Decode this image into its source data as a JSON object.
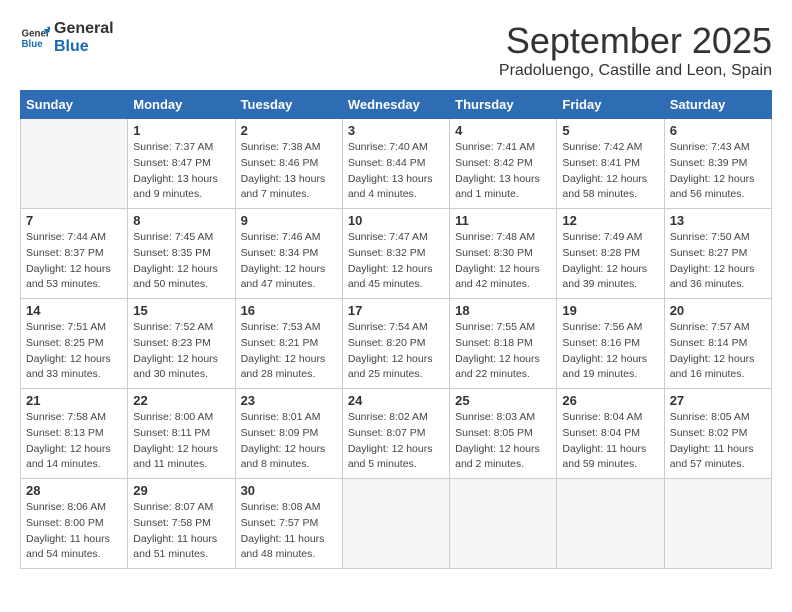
{
  "logo": {
    "line1": "General",
    "line2": "Blue"
  },
  "title": "September 2025",
  "location": "Pradoluengo, Castille and Leon, Spain",
  "headers": [
    "Sunday",
    "Monday",
    "Tuesday",
    "Wednesday",
    "Thursday",
    "Friday",
    "Saturday"
  ],
  "weeks": [
    [
      {
        "day": "",
        "info": ""
      },
      {
        "day": "1",
        "info": "Sunrise: 7:37 AM\nSunset: 8:47 PM\nDaylight: 13 hours\nand 9 minutes."
      },
      {
        "day": "2",
        "info": "Sunrise: 7:38 AM\nSunset: 8:46 PM\nDaylight: 13 hours\nand 7 minutes."
      },
      {
        "day": "3",
        "info": "Sunrise: 7:40 AM\nSunset: 8:44 PM\nDaylight: 13 hours\nand 4 minutes."
      },
      {
        "day": "4",
        "info": "Sunrise: 7:41 AM\nSunset: 8:42 PM\nDaylight: 13 hours\nand 1 minute."
      },
      {
        "day": "5",
        "info": "Sunrise: 7:42 AM\nSunset: 8:41 PM\nDaylight: 12 hours\nand 58 minutes."
      },
      {
        "day": "6",
        "info": "Sunrise: 7:43 AM\nSunset: 8:39 PM\nDaylight: 12 hours\nand 56 minutes."
      }
    ],
    [
      {
        "day": "7",
        "info": "Sunrise: 7:44 AM\nSunset: 8:37 PM\nDaylight: 12 hours\nand 53 minutes."
      },
      {
        "day": "8",
        "info": "Sunrise: 7:45 AM\nSunset: 8:35 PM\nDaylight: 12 hours\nand 50 minutes."
      },
      {
        "day": "9",
        "info": "Sunrise: 7:46 AM\nSunset: 8:34 PM\nDaylight: 12 hours\nand 47 minutes."
      },
      {
        "day": "10",
        "info": "Sunrise: 7:47 AM\nSunset: 8:32 PM\nDaylight: 12 hours\nand 45 minutes."
      },
      {
        "day": "11",
        "info": "Sunrise: 7:48 AM\nSunset: 8:30 PM\nDaylight: 12 hours\nand 42 minutes."
      },
      {
        "day": "12",
        "info": "Sunrise: 7:49 AM\nSunset: 8:28 PM\nDaylight: 12 hours\nand 39 minutes."
      },
      {
        "day": "13",
        "info": "Sunrise: 7:50 AM\nSunset: 8:27 PM\nDaylight: 12 hours\nand 36 minutes."
      }
    ],
    [
      {
        "day": "14",
        "info": "Sunrise: 7:51 AM\nSunset: 8:25 PM\nDaylight: 12 hours\nand 33 minutes."
      },
      {
        "day": "15",
        "info": "Sunrise: 7:52 AM\nSunset: 8:23 PM\nDaylight: 12 hours\nand 30 minutes."
      },
      {
        "day": "16",
        "info": "Sunrise: 7:53 AM\nSunset: 8:21 PM\nDaylight: 12 hours\nand 28 minutes."
      },
      {
        "day": "17",
        "info": "Sunrise: 7:54 AM\nSunset: 8:20 PM\nDaylight: 12 hours\nand 25 minutes."
      },
      {
        "day": "18",
        "info": "Sunrise: 7:55 AM\nSunset: 8:18 PM\nDaylight: 12 hours\nand 22 minutes."
      },
      {
        "day": "19",
        "info": "Sunrise: 7:56 AM\nSunset: 8:16 PM\nDaylight: 12 hours\nand 19 minutes."
      },
      {
        "day": "20",
        "info": "Sunrise: 7:57 AM\nSunset: 8:14 PM\nDaylight: 12 hours\nand 16 minutes."
      }
    ],
    [
      {
        "day": "21",
        "info": "Sunrise: 7:58 AM\nSunset: 8:13 PM\nDaylight: 12 hours\nand 14 minutes."
      },
      {
        "day": "22",
        "info": "Sunrise: 8:00 AM\nSunset: 8:11 PM\nDaylight: 12 hours\nand 11 minutes."
      },
      {
        "day": "23",
        "info": "Sunrise: 8:01 AM\nSunset: 8:09 PM\nDaylight: 12 hours\nand 8 minutes."
      },
      {
        "day": "24",
        "info": "Sunrise: 8:02 AM\nSunset: 8:07 PM\nDaylight: 12 hours\nand 5 minutes."
      },
      {
        "day": "25",
        "info": "Sunrise: 8:03 AM\nSunset: 8:05 PM\nDaylight: 12 hours\nand 2 minutes."
      },
      {
        "day": "26",
        "info": "Sunrise: 8:04 AM\nSunset: 8:04 PM\nDaylight: 11 hours\nand 59 minutes."
      },
      {
        "day": "27",
        "info": "Sunrise: 8:05 AM\nSunset: 8:02 PM\nDaylight: 11 hours\nand 57 minutes."
      }
    ],
    [
      {
        "day": "28",
        "info": "Sunrise: 8:06 AM\nSunset: 8:00 PM\nDaylight: 11 hours\nand 54 minutes."
      },
      {
        "day": "29",
        "info": "Sunrise: 8:07 AM\nSunset: 7:58 PM\nDaylight: 11 hours\nand 51 minutes."
      },
      {
        "day": "30",
        "info": "Sunrise: 8:08 AM\nSunset: 7:57 PM\nDaylight: 11 hours\nand 48 minutes."
      },
      {
        "day": "",
        "info": ""
      },
      {
        "day": "",
        "info": ""
      },
      {
        "day": "",
        "info": ""
      },
      {
        "day": "",
        "info": ""
      }
    ]
  ]
}
